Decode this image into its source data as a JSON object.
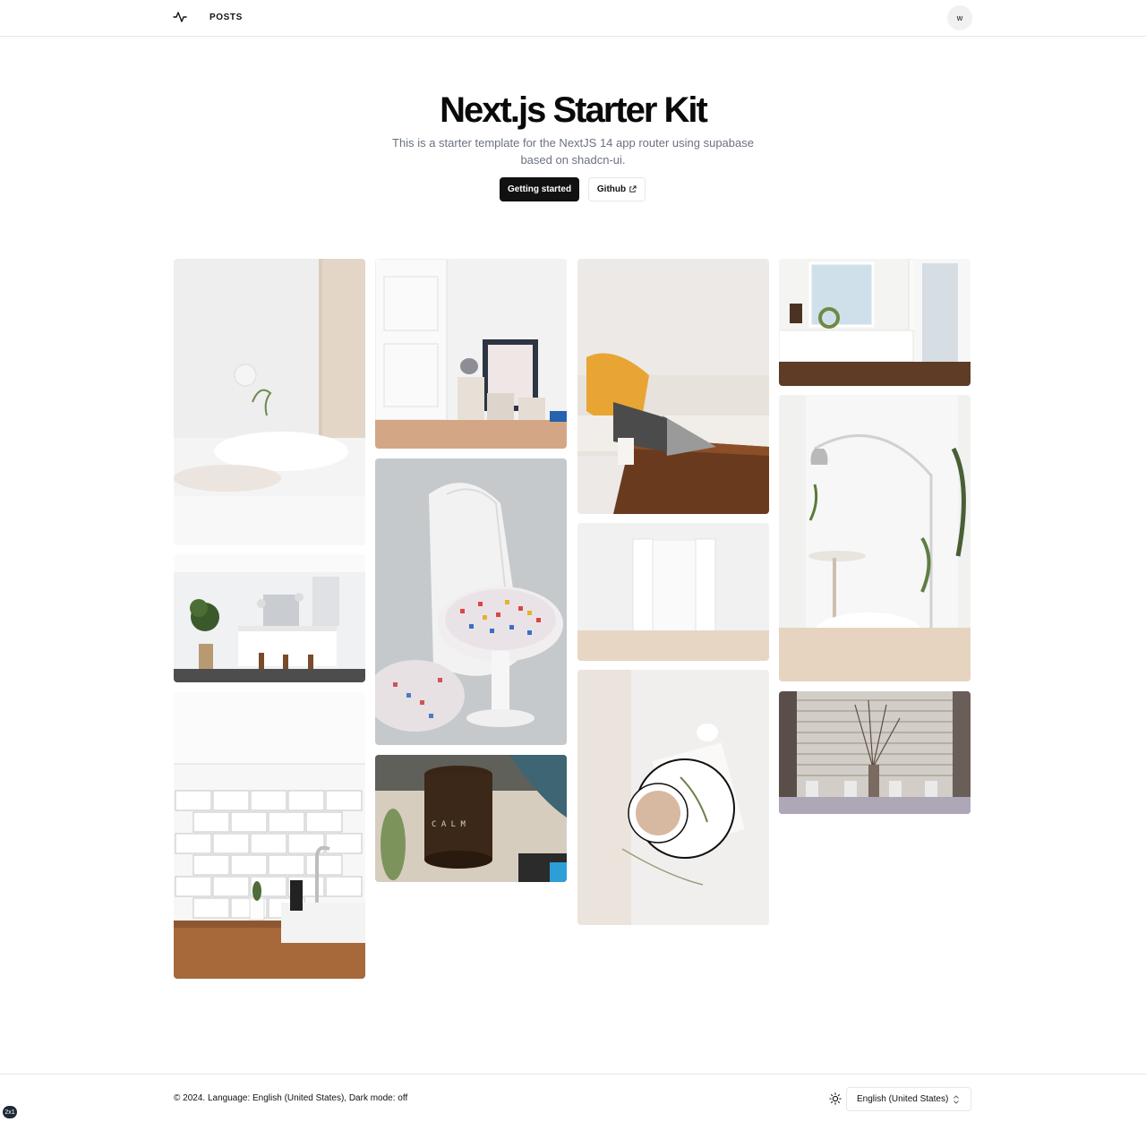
{
  "header": {
    "logo_icon": "activity-pulse-icon",
    "nav_posts": "POSTS",
    "avatar_initial": "w"
  },
  "hero": {
    "title": "Next.js Starter Kit",
    "subtitle": "This is a starter template for the NextJS 14 app router using supabase based on shadcn-ui.",
    "primary_button": "Getting started",
    "secondary_button": "Github",
    "secondary_icon": "external-link-icon"
  },
  "gallery": {
    "photos": [
      {
        "name": "photo-bedroom-pillow"
      },
      {
        "name": "photo-kitchen-island"
      },
      {
        "name": "photo-kitchen-sink-tiles"
      },
      {
        "name": "photo-door-books"
      },
      {
        "name": "photo-tulip-chair"
      },
      {
        "name": "photo-candle-jar"
      },
      {
        "name": "photo-sofa-laptop"
      },
      {
        "name": "photo-open-doors"
      },
      {
        "name": "photo-coffee-bed"
      },
      {
        "name": "photo-mudroom-bench"
      },
      {
        "name": "photo-arc-lamp-dining"
      },
      {
        "name": "photo-window-vases"
      }
    ]
  },
  "footer": {
    "text": "© 2024. Language: English (United States), Dark mode: off",
    "theme_icon": "sun-icon",
    "language_select": "English (United States)",
    "select_icon": "chevron-up-down-icon"
  },
  "badge": "2x1"
}
